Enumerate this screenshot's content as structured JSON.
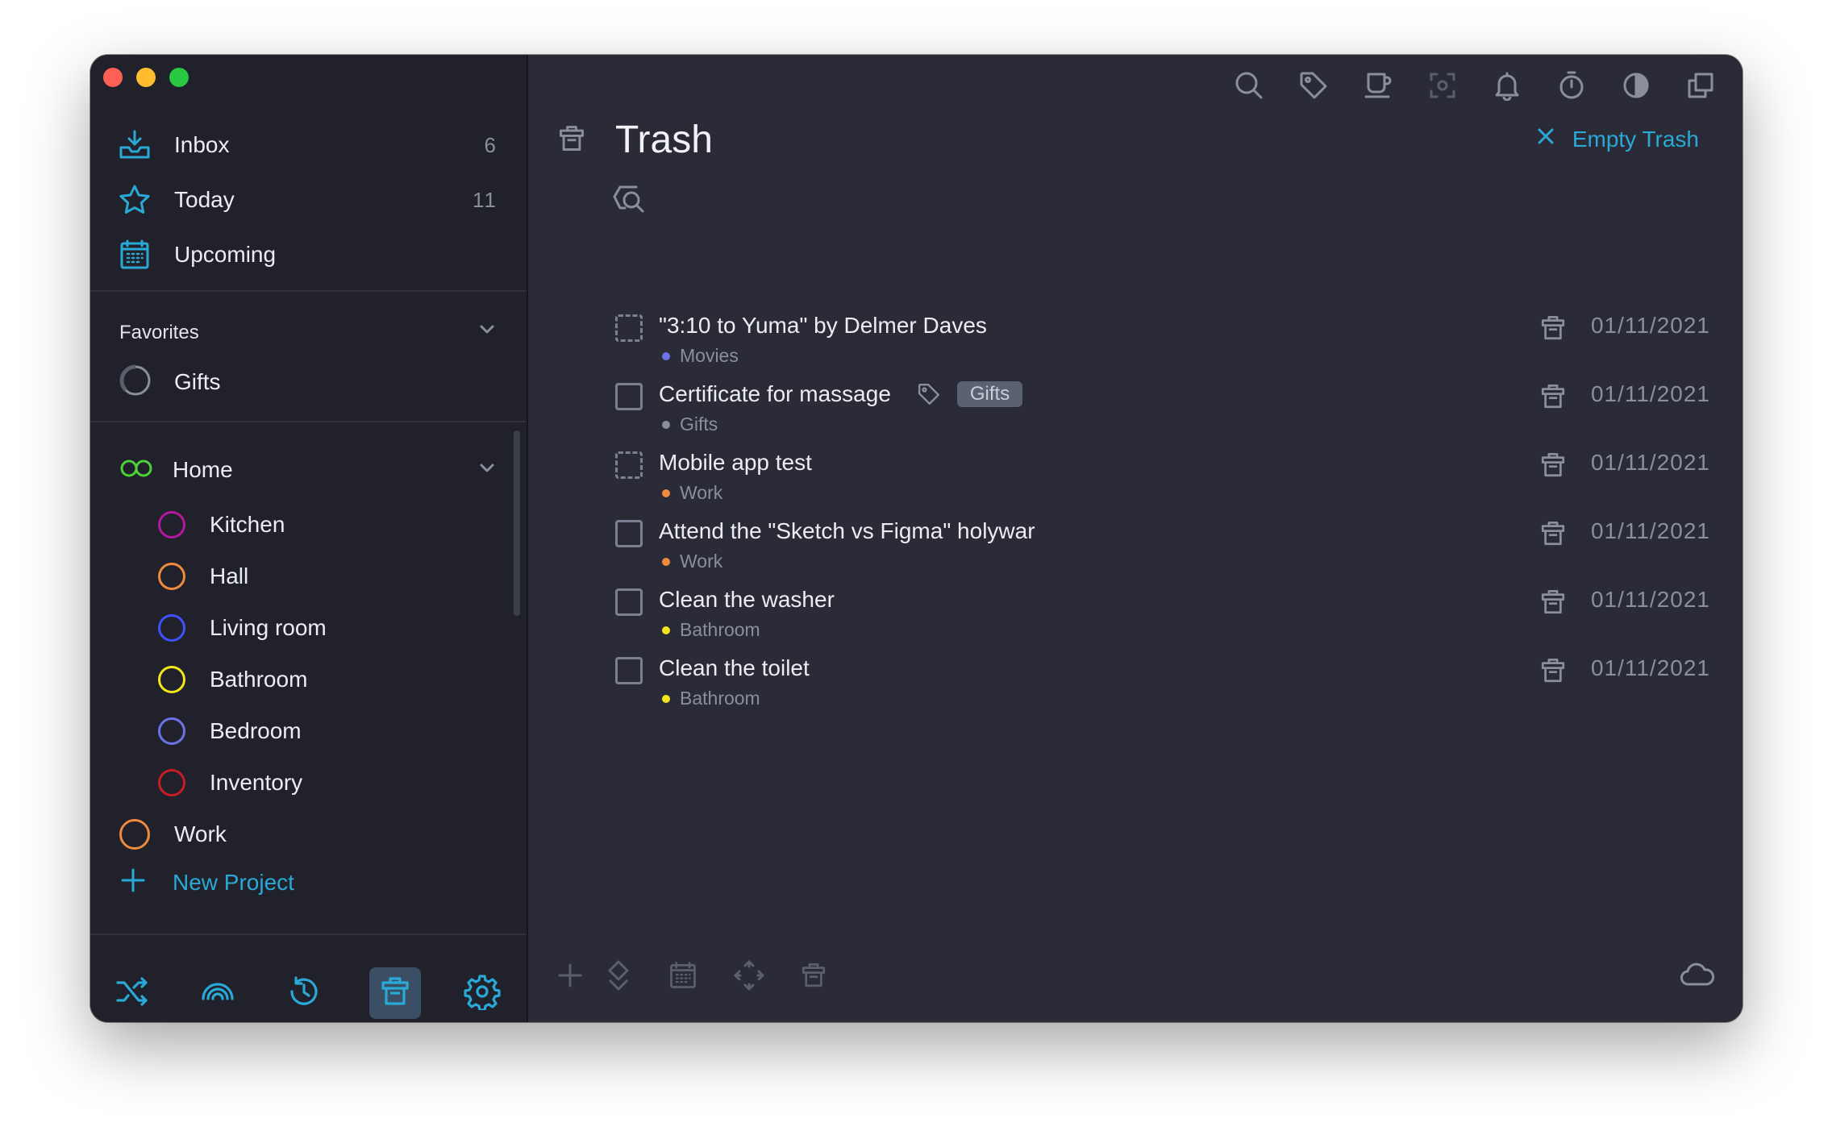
{
  "sidebar": {
    "nav": [
      {
        "label": "Inbox",
        "count": "6",
        "icon": "inbox-icon"
      },
      {
        "label": "Today",
        "count": "11",
        "icon": "star-icon"
      },
      {
        "label": "Upcoming",
        "count": "",
        "icon": "calendar-icon"
      }
    ],
    "favorites": {
      "header": "Favorites",
      "items": [
        {
          "label": "Gifts",
          "color": "#8b8e9b"
        }
      ]
    },
    "projects": {
      "home": {
        "label": "Home",
        "color": "#4cd137"
      },
      "home_children": [
        {
          "label": "Kitchen",
          "color": "#b5179e"
        },
        {
          "label": "Hall",
          "color": "#f08a3c"
        },
        {
          "label": "Living room",
          "color": "#3f51ff"
        },
        {
          "label": "Bathroom",
          "color": "#f5e61c"
        },
        {
          "label": "Bedroom",
          "color": "#6c72e8"
        },
        {
          "label": "Inventory",
          "color": "#c81d25"
        }
      ],
      "work": {
        "label": "Work",
        "color": "#f08a3c"
      }
    },
    "new_project": "New Project",
    "bottom": [
      "shuffle-icon",
      "rainbow-icon",
      "history-icon",
      "trash-icon",
      "gear-icon"
    ]
  },
  "main": {
    "title": "Trash",
    "empty_trash": "Empty Trash",
    "toolbar": [
      "search-icon",
      "tag-icon",
      "coffee-icon",
      "focus-icon",
      "bell-icon",
      "timer-icon",
      "contrast-icon",
      "windows-icon"
    ],
    "tasks": [
      {
        "name": "\"3:10 to Yuma\" by Delmer Daves",
        "project": "Movies",
        "dot": "#6c72e8",
        "dashed": true,
        "tag": "",
        "date": "01/11/2021"
      },
      {
        "name": "Certificate for massage",
        "project": "Gifts",
        "dot": "#8b8e9b",
        "dashed": false,
        "tag": "Gifts",
        "date": "01/11/2021"
      },
      {
        "name": "Mobile app test",
        "project": "Work",
        "dot": "#f08a3c",
        "dashed": true,
        "tag": "",
        "date": "01/11/2021"
      },
      {
        "name": "Attend the \"Sketch vs Figma\" holywar",
        "project": "Work",
        "dot": "#f08a3c",
        "dashed": false,
        "tag": "",
        "date": "01/11/2021"
      },
      {
        "name": "Clean the washer",
        "project": "Bathroom",
        "dot": "#f5e61c",
        "dashed": false,
        "tag": "",
        "date": "01/11/2021"
      },
      {
        "name": "Clean the toilet",
        "project": "Bathroom",
        "dot": "#f5e61c",
        "dashed": false,
        "tag": "",
        "date": "01/11/2021"
      }
    ],
    "bottom": [
      "add-icon",
      "diamond-icon",
      "calendar-icon",
      "move-icon",
      "trash-icon",
      "cloud-icon"
    ]
  },
  "colors": {
    "accent": "#2aa9d6",
    "sidebar_bg": "#20212a",
    "main_bg": "#2a2b37"
  }
}
